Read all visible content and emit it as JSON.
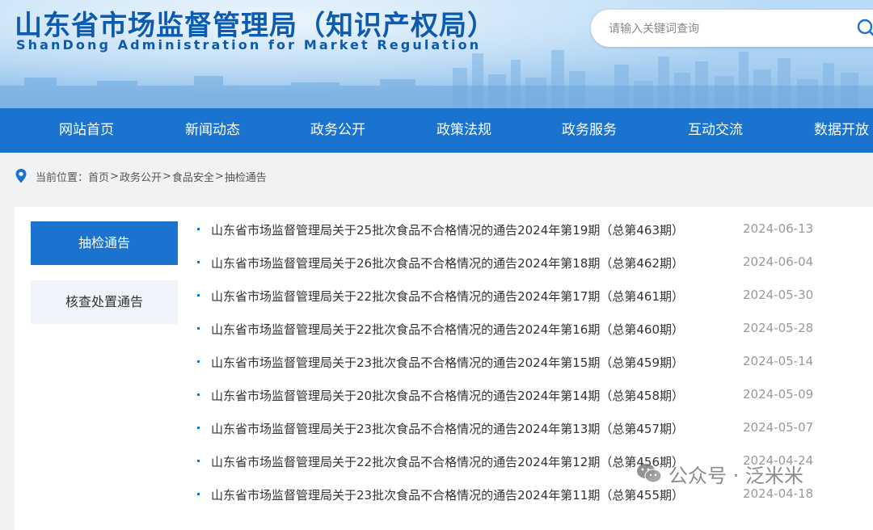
{
  "header": {
    "title_cn": "山东省市场监督管理局（知识产权局）",
    "title_en": "ShanDong Administration for Market Regulation"
  },
  "search": {
    "placeholder": "请输入关键词查询",
    "value": ""
  },
  "nav": {
    "items": [
      {
        "label": "网站首页"
      },
      {
        "label": "新闻动态"
      },
      {
        "label": "政务公开"
      },
      {
        "label": "政策法规"
      },
      {
        "label": "政务服务"
      },
      {
        "label": "互动交流"
      },
      {
        "label": "数据开放"
      }
    ]
  },
  "breadcrumb": {
    "prefix": "当前位置：",
    "items": [
      "首页",
      "政务公开",
      "食品安全",
      "抽检通告"
    ],
    "separator": ">"
  },
  "sidebar": {
    "items": [
      {
        "label": "抽检通告",
        "active": true
      },
      {
        "label": "核查处置通告",
        "active": false
      }
    ]
  },
  "news": {
    "items": [
      {
        "title": "山东省市场监督管理局关于25批次食品不合格情况的通告2024年第19期（总第463期）",
        "date": "2024-06-13"
      },
      {
        "title": "山东省市场监督管理局关于26批次食品不合格情况的通告2024年第18期（总第462期）",
        "date": "2024-06-04"
      },
      {
        "title": "山东省市场监督管理局关于22批次食品不合格情况的通告2024年第17期（总第461期）",
        "date": "2024-05-30"
      },
      {
        "title": "山东省市场监督管理局关于22批次食品不合格情况的通告2024年第16期（总第460期）",
        "date": "2024-05-28"
      },
      {
        "title": "山东省市场监督管理局关于23批次食品不合格情况的通告2024年第15期（总第459期）",
        "date": "2024-05-14"
      },
      {
        "title": "山东省市场监督管理局关于20批次食品不合格情况的通告2024年第14期（总第458期）",
        "date": "2024-05-09"
      },
      {
        "title": "山东省市场监督管理局关于23批次食品不合格情况的通告2024年第13期（总第457期）",
        "date": "2024-05-07"
      },
      {
        "title": "山东省市场监督管理局关于22批次食品不合格情况的通告2024年第12期（总第456期）",
        "date": "2024-04-24"
      },
      {
        "title": "山东省市场监督管理局关于23批次食品不合格情况的通告2024年第11期（总第455期）",
        "date": "2024-04-18"
      }
    ]
  },
  "watermark": {
    "text": "公众号 · 泛米米"
  },
  "colors": {
    "brand_blue": "#1a74cf",
    "title_blue": "#0c5bb0",
    "date_gray": "#999999"
  },
  "icons": {
    "search": "search-icon",
    "location": "location-pin-icon",
    "watermark": "wechat-icon"
  }
}
